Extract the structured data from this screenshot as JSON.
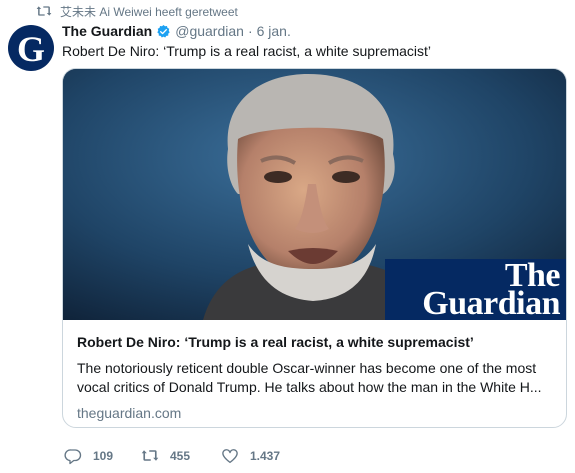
{
  "retweet_notice": "艾未未 Ai Weiwei heeft geretweet",
  "author": {
    "name": "The Guardian",
    "handle": "@guardian",
    "separator": "·",
    "date": "6 jan.",
    "avatar_letter": "G"
  },
  "tweet_text": "Robert De Niro: ‘Trump is a real racist, a white supremacist’",
  "card": {
    "logo_line1": "The",
    "logo_line2": "Guardian",
    "title": "Robert De Niro: ‘Trump is a real racist, a white supremacist’",
    "description": "The notoriously reticent double Oscar-winner has become one of the most vocal critics of Donald Trump. He talks about how the man in the White H...",
    "domain": "theguardian.com"
  },
  "actions": {
    "replies": "109",
    "retweets": "455",
    "likes": "1.437"
  },
  "colors": {
    "guardian_blue": "#052962",
    "verified_blue": "#1da1f2",
    "muted_text": "#657786"
  }
}
